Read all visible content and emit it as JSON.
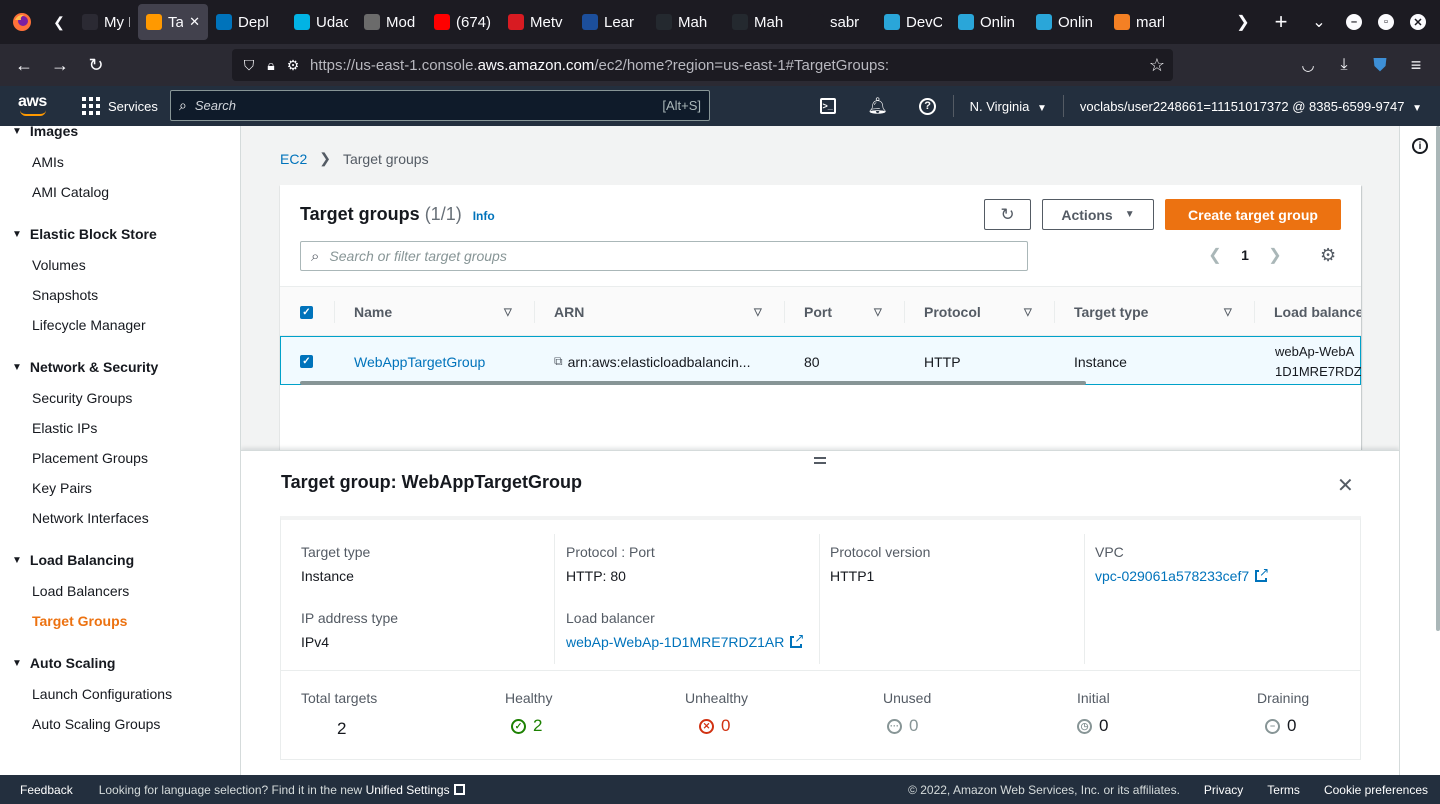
{
  "browser": {
    "tabs": [
      {
        "label": "My P",
        "color": "#2b2a33"
      },
      {
        "label": "Tar",
        "color": "#ff9900",
        "active": true
      },
      {
        "label": "Depl",
        "color": "#0073bb"
      },
      {
        "label": "Udac",
        "color": "#02b3e4"
      },
      {
        "label": "Mod",
        "color": "#6b6b6b"
      },
      {
        "label": "(674)",
        "color": "#ff0000"
      },
      {
        "label": "Metv",
        "color": "#d81b22"
      },
      {
        "label": "Lear",
        "color": "#1c4f9c"
      },
      {
        "label": "Mah",
        "color": "#24292f"
      },
      {
        "label": "Mah",
        "color": "#24292f"
      },
      {
        "label": "sabr",
        "color": "#1c1b22"
      },
      {
        "label": "DevC",
        "color": "#2aa6d9"
      },
      {
        "label": "Onlin",
        "color": "#2aa6d9"
      },
      {
        "label": "Onlin",
        "color": "#2aa6d9"
      },
      {
        "label": "mark",
        "color": "#f48024"
      }
    ],
    "url_prefix": "https://us-east-1.console.",
    "url_domain": "aws.amazon.com",
    "url_suffix": "/ec2/home?region=us-east-1#TargetGroups:"
  },
  "aws": {
    "services_label": "Services",
    "search_placeholder": "Search",
    "search_hint": "[Alt+S]",
    "region": "N. Virginia",
    "user": "voclabs/user2248661=11151017372 @ 8385-6599-9747"
  },
  "sidebar": {
    "sections": [
      {
        "title": "Images",
        "items": [
          "AMIs",
          "AMI Catalog"
        ]
      },
      {
        "title": "Elastic Block Store",
        "items": [
          "Volumes",
          "Snapshots",
          "Lifecycle Manager"
        ]
      },
      {
        "title": "Network & Security",
        "items": [
          "Security Groups",
          "Elastic IPs",
          "Placement Groups",
          "Key Pairs",
          "Network Interfaces"
        ]
      },
      {
        "title": "Load Balancing",
        "items": [
          "Load Balancers",
          "Target Groups"
        ]
      },
      {
        "title": "Auto Scaling",
        "items": [
          "Launch Configurations",
          "Auto Scaling Groups"
        ]
      }
    ],
    "active_item": "Target Groups"
  },
  "breadcrumb": {
    "root": "EC2",
    "current": "Target groups"
  },
  "target_groups": {
    "title": "Target groups",
    "count": "(1/1)",
    "info": "Info",
    "actions_label": "Actions",
    "create_label": "Create target group",
    "filter_placeholder": "Search or filter target groups",
    "page": "1",
    "columns": [
      "Name",
      "ARN",
      "Port",
      "Protocol",
      "Target type",
      "Load balance"
    ],
    "row": {
      "name": "WebAppTargetGroup",
      "arn": "arn:aws:elasticloadbalancin...",
      "port": "80",
      "protocol": "HTTP",
      "target_type": "Instance",
      "load_balancer_line1": "webAp-WebA",
      "load_balancer_line2": "1D1MRE7RDZ"
    }
  },
  "details": {
    "title": "Target group: WebAppTargetGroup",
    "target_type_label": "Target type",
    "target_type": "Instance",
    "protocol_port_label": "Protocol : Port",
    "protocol_port": "HTTP: 80",
    "protocol_version_label": "Protocol version",
    "protocol_version": "HTTP1",
    "vpc_label": "VPC",
    "vpc": "vpc-029061a578233cef7",
    "ip_type_label": "IP address type",
    "ip_type": "IPv4",
    "lb_label": "Load balancer",
    "lb": "webAp-WebAp-1D1MRE7RDZ1AR",
    "stats": {
      "total_label": "Total targets",
      "total": "2",
      "healthy_label": "Healthy",
      "healthy": "2",
      "unhealthy_label": "Unhealthy",
      "unhealthy": "0",
      "unused_label": "Unused",
      "unused": "0",
      "initial_label": "Initial",
      "initial": "0",
      "draining_label": "Draining",
      "draining": "0"
    },
    "colors": {
      "healthy": "#1d8102",
      "unhealthy": "#d13212",
      "neutral": "#879596"
    }
  },
  "footer": {
    "feedback": "Feedback",
    "lang_text": "Looking for language selection? Find it in the new",
    "lang_link": "Unified Settings",
    "copyright": "© 2022, Amazon Web Services, Inc. or its affiliates.",
    "privacy": "Privacy",
    "terms": "Terms",
    "cookies": "Cookie preferences"
  }
}
